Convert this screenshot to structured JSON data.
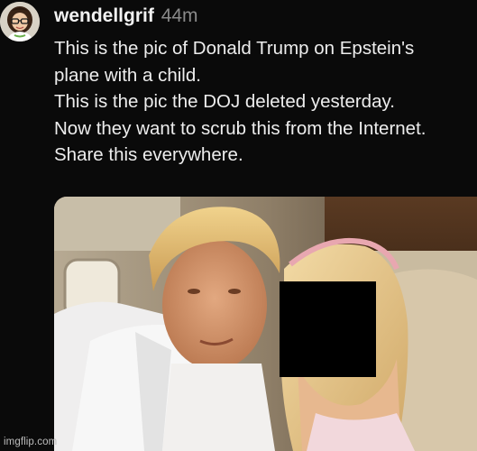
{
  "post": {
    "username": "wendellgrif",
    "timestamp": "44m",
    "lines": [
      "This is the pic of Donald Trump on Epstein's",
      "plane with a child.",
      "This is the pic the DOJ deleted yesterday.",
      "Now they want to scrub this from the Internet.",
      "Share this everywhere."
    ]
  },
  "avatar": {
    "icon": "cartoon-avatar-icon"
  },
  "photo": {
    "content": "attached-photo",
    "censor_color": "#000000"
  },
  "watermark": "imgflip.com"
}
